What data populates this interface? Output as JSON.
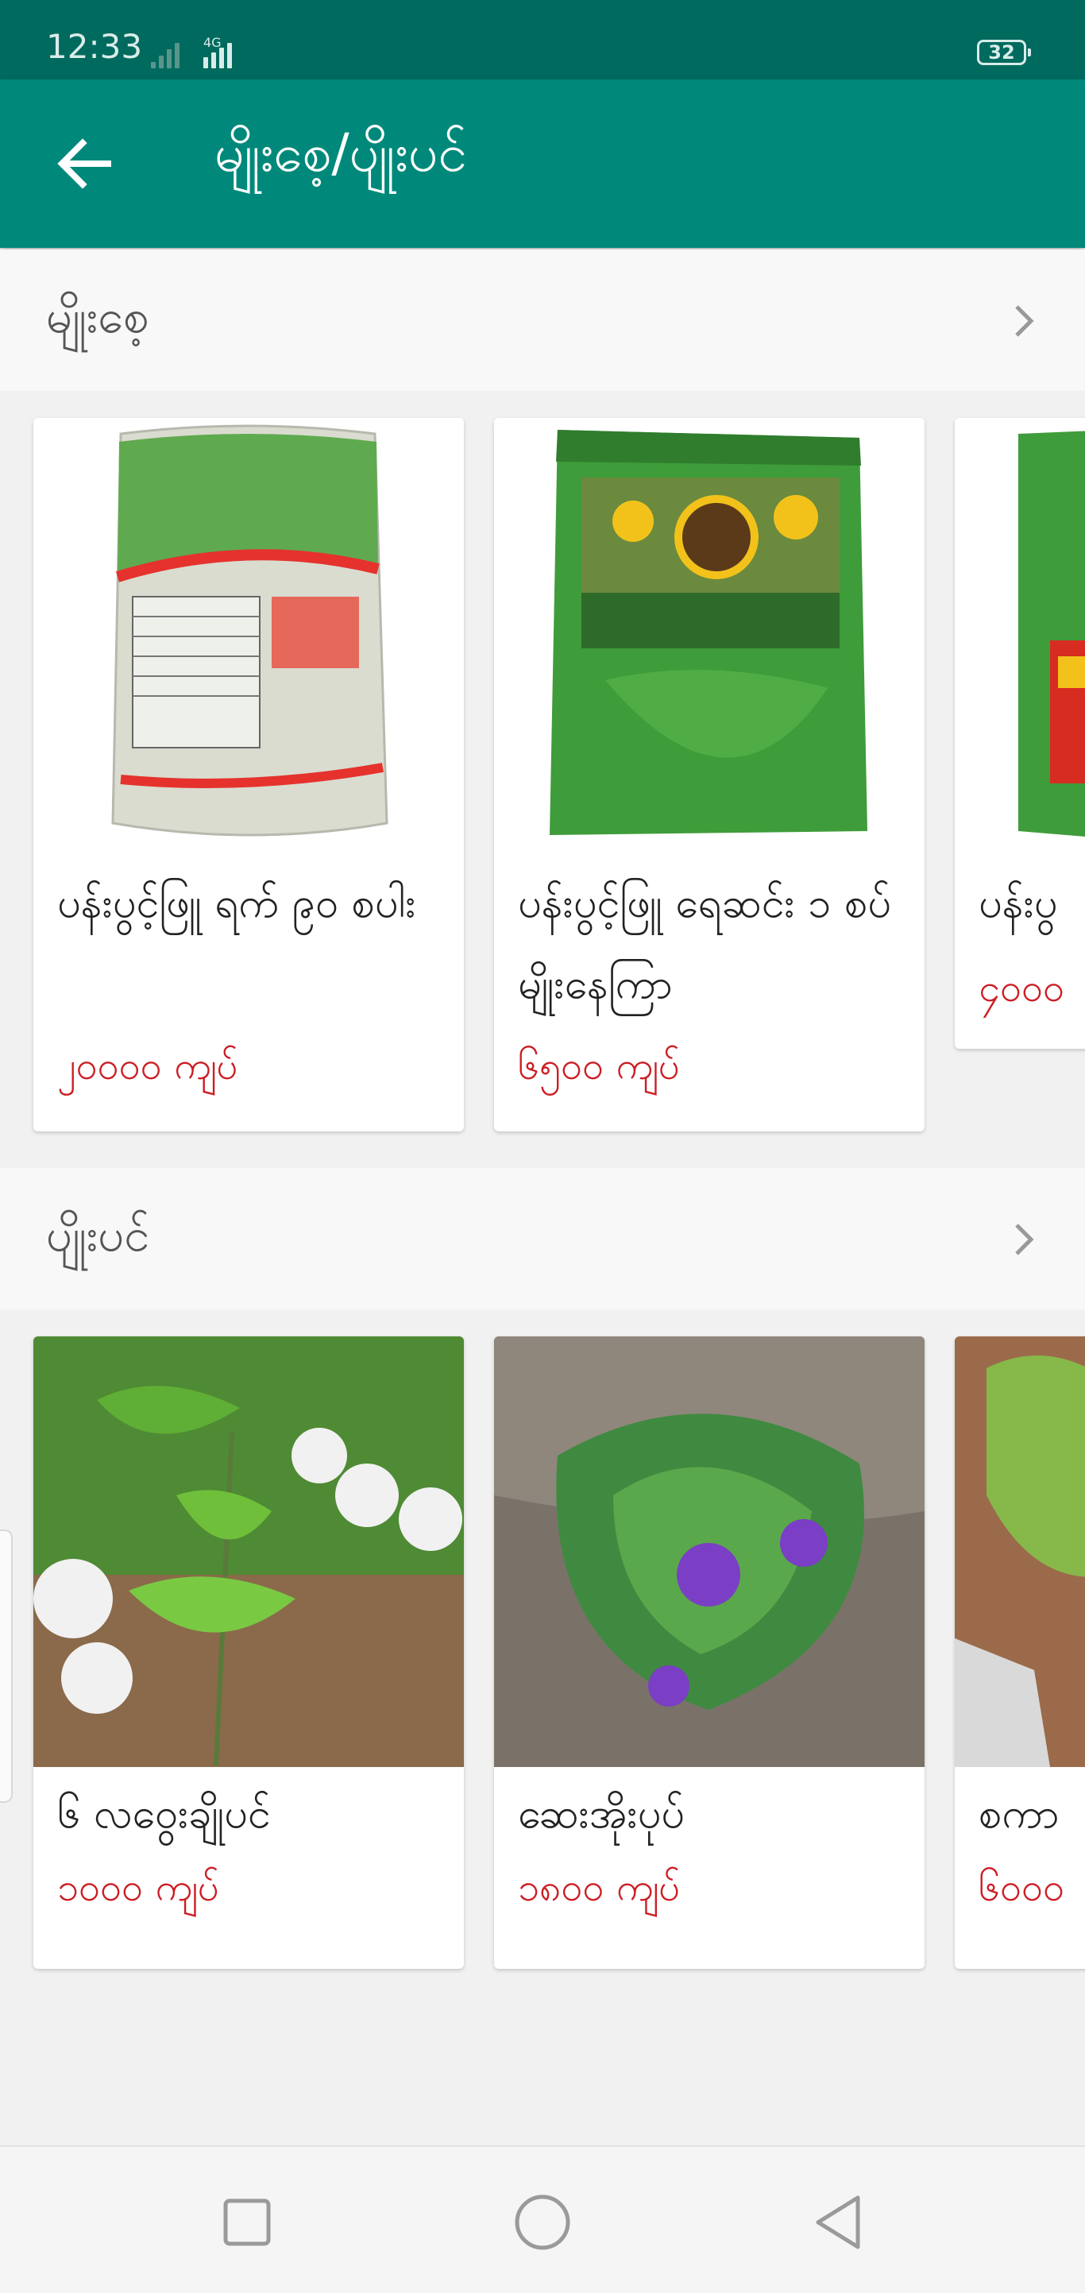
{
  "status_bar": {
    "time": "12:33",
    "network": "4G",
    "battery": "32"
  },
  "header": {
    "title": "မျိုးစေ့/ပျိုးပင်"
  },
  "sections": [
    {
      "title": "မျိုးစေ့",
      "items": [
        {
          "name": "ပန်းပွင့်ဖြူ ရက် ၉၀ စပါး",
          "price": "၂၀၀၀၀ ကျပ်"
        },
        {
          "name": "ပန်းပွင့်ဖြူ ရေဆင်း ၁ စပ်မျိုးနေကြာ",
          "price": "၆၅၀၀ ကျပ်"
        },
        {
          "name": "ပန်းပွ",
          "price": "၄၀၀၀"
        }
      ]
    },
    {
      "title": "ပျိုးပင်",
      "items": [
        {
          "name": "၆ လဝွေးချိုပင်",
          "price": "၁၀၀၀ ကျပ်"
        },
        {
          "name": "ဆေးအိုးပုပ်",
          "price": "၁၈၀၀ ကျပ်"
        },
        {
          "name": "စကာ",
          "price": "၆၀၀၀"
        }
      ]
    }
  ],
  "colors": {
    "primary": "#00897b",
    "status_bar": "#006a5e",
    "price": "#cc1d24"
  }
}
